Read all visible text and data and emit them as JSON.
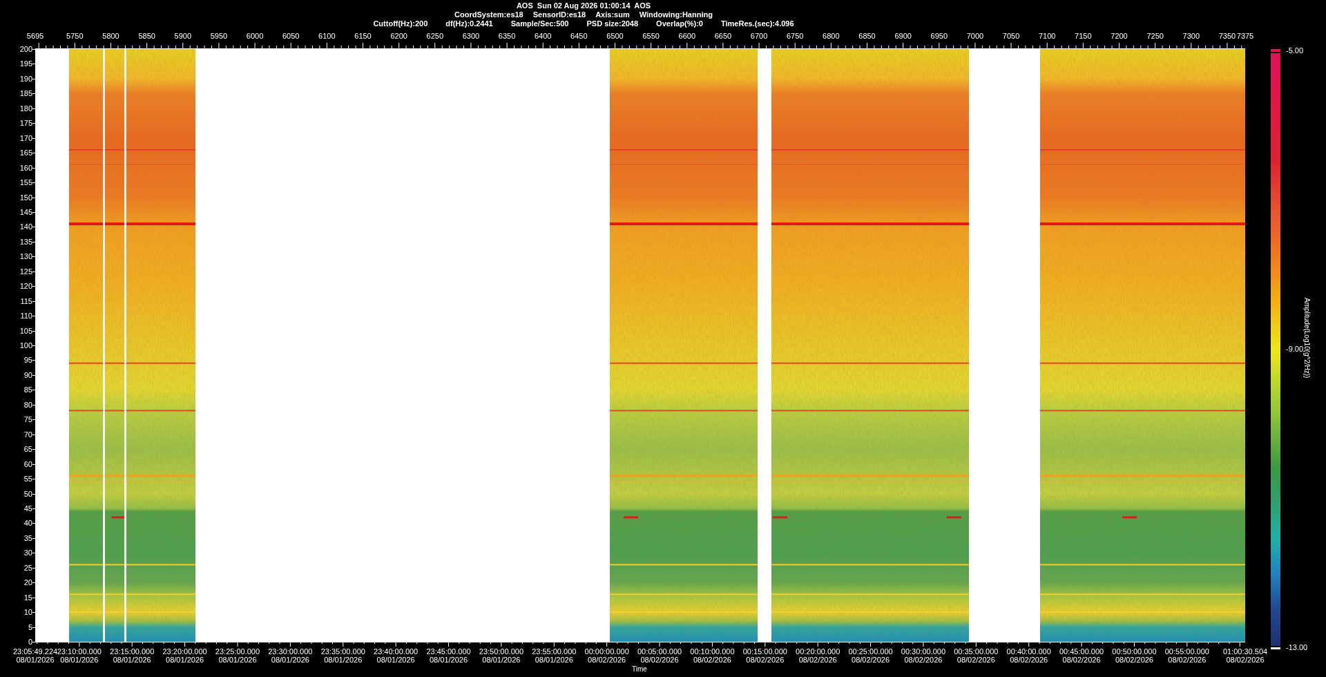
{
  "header": {
    "title": "AOS  Sun 02 Aug 2026 01:00:14  AOS",
    "info_lines": [
      [
        "CoordSystem:es18",
        "SensorID:es18",
        "Axis:sum",
        "Windowing:Hanning"
      ],
      [
        "Cuttoff(Hz):200",
        "df(Hz):0.2441",
        "Sample/Sec:500",
        "PSD size:2048",
        "Overlap(%):0",
        "TimeRes.(sec):4.096"
      ]
    ]
  },
  "top_axis": {
    "ticks": [
      "5695",
      "5750",
      "5800",
      "5850",
      "5900",
      "5950",
      "6000",
      "6050",
      "6100",
      "6150",
      "6200",
      "6250",
      "6300",
      "6350",
      "6400",
      "6450",
      "6500",
      "6550",
      "6600",
      "6650",
      "6700",
      "6750",
      "6800",
      "6850",
      "6900",
      "6950",
      "7000",
      "7050",
      "7100",
      "7150",
      "7200",
      "7250",
      "7300",
      "7350",
      "7375"
    ]
  },
  "y_axis": {
    "ticks": [
      "200",
      "195",
      "190",
      "185",
      "180",
      "175",
      "170",
      "165",
      "160",
      "155",
      "150",
      "145",
      "140",
      "135",
      "130",
      "125",
      "120",
      "115",
      "110",
      "105",
      "100",
      "95",
      "90",
      "85",
      "80",
      "75",
      "70",
      "65",
      "60",
      "55",
      "50",
      "45",
      "40",
      "35",
      "30",
      "25",
      "20",
      "15",
      "10",
      "5",
      "0"
    ]
  },
  "time_axis": {
    "title": "Time",
    "ticks": [
      {
        "time": "23:05:49.224",
        "date": "08/01/2026"
      },
      {
        "time": "23:10:00.000",
        "date": "08/01/2026"
      },
      {
        "time": "23:15:00.000",
        "date": "08/01/2026"
      },
      {
        "time": "23:20:00.000",
        "date": "08/01/2026"
      },
      {
        "time": "23:25:00.000",
        "date": "08/01/2026"
      },
      {
        "time": "23:30:00.000",
        "date": "08/01/2026"
      },
      {
        "time": "23:35:00.000",
        "date": "08/01/2026"
      },
      {
        "time": "23:40:00.000",
        "date": "08/01/2026"
      },
      {
        "time": "23:45:00.000",
        "date": "08/01/2026"
      },
      {
        "time": "23:50:00.000",
        "date": "08/01/2026"
      },
      {
        "time": "23:55:00.000",
        "date": "08/01/2026"
      },
      {
        "time": "00:00:00.000",
        "date": "08/02/2026"
      },
      {
        "time": "00:05:00.000",
        "date": "08/02/2026"
      },
      {
        "time": "00:10:00.000",
        "date": "08/02/2026"
      },
      {
        "time": "00:15:00.000",
        "date": "08/02/2026"
      },
      {
        "time": "00:20:00.000",
        "date": "08/02/2026"
      },
      {
        "time": "00:25:00.000",
        "date": "08/02/2026"
      },
      {
        "time": "00:30:00.000",
        "date": "08/02/2026"
      },
      {
        "time": "00:35:00.000",
        "date": "08/02/2026"
      },
      {
        "time": "00:40:00.000",
        "date": "08/02/2026"
      },
      {
        "time": "00:45:00.000",
        "date": "08/02/2026"
      },
      {
        "time": "00:50:00.000",
        "date": "08/02/2026"
      },
      {
        "time": "00:55:00.000",
        "date": "08/02/2026"
      },
      {
        "time": "01:00:30.504",
        "date": "08/02/2026"
      }
    ]
  },
  "colorbar": {
    "title": "Amplitude(Log10(g^2/Hz))",
    "ticks": [
      "-5.00",
      "-9.00",
      "-13.00"
    ]
  }
}
